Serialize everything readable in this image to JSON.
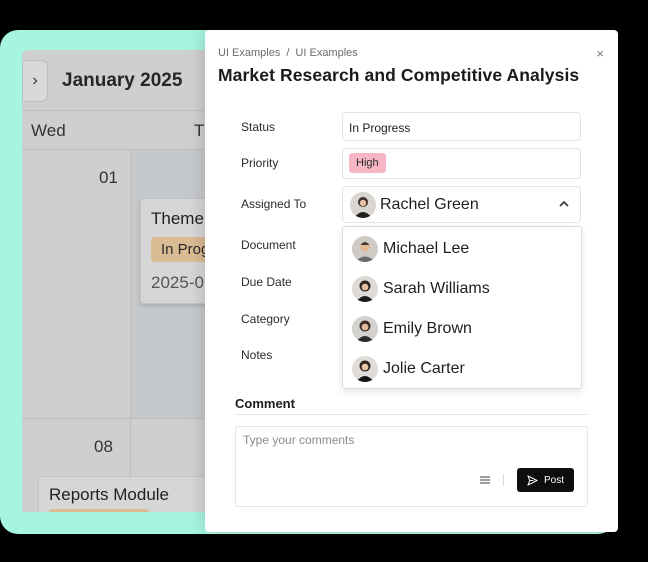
{
  "calendar": {
    "month": "January 2025",
    "day_wed": "Wed",
    "day_next": "T",
    "date_1": "01",
    "date_2": "08",
    "event1": {
      "title": "Theme",
      "badge": "In Prog",
      "date": "2025-0"
    },
    "event2": {
      "title": "Reports Module"
    }
  },
  "modal": {
    "breadcrumb": [
      "UI Examples",
      "UI Examples"
    ],
    "breadcrumb_sep": "/",
    "close_label": "×",
    "title": "Market Research and Competitive Analysis",
    "labels": {
      "status": "Status",
      "priority": "Priority",
      "assigned_to": "Assigned To",
      "document": "Document",
      "due_date": "Due Date",
      "category": "Category",
      "notes": "Notes"
    },
    "status_value": "In Progress",
    "priority_value": "High",
    "priority_color": "#f7b6c3",
    "assigned_value": "Rachel Green",
    "assignee_options": [
      "Michael Lee",
      "Sarah Williams",
      "Emily Brown",
      "Jolie Carter"
    ],
    "comment": {
      "heading": "Comment",
      "placeholder": "Type your comments",
      "post_label": "Post"
    }
  },
  "colors": {
    "accent_background": "#a6f5e0",
    "post_button": "#0d0d0d",
    "in_progress_badge": "#d9bb94"
  },
  "icons": [
    "chevron-right-icon",
    "close-icon",
    "chevron-up-icon",
    "menu-icon",
    "send-icon"
  ]
}
